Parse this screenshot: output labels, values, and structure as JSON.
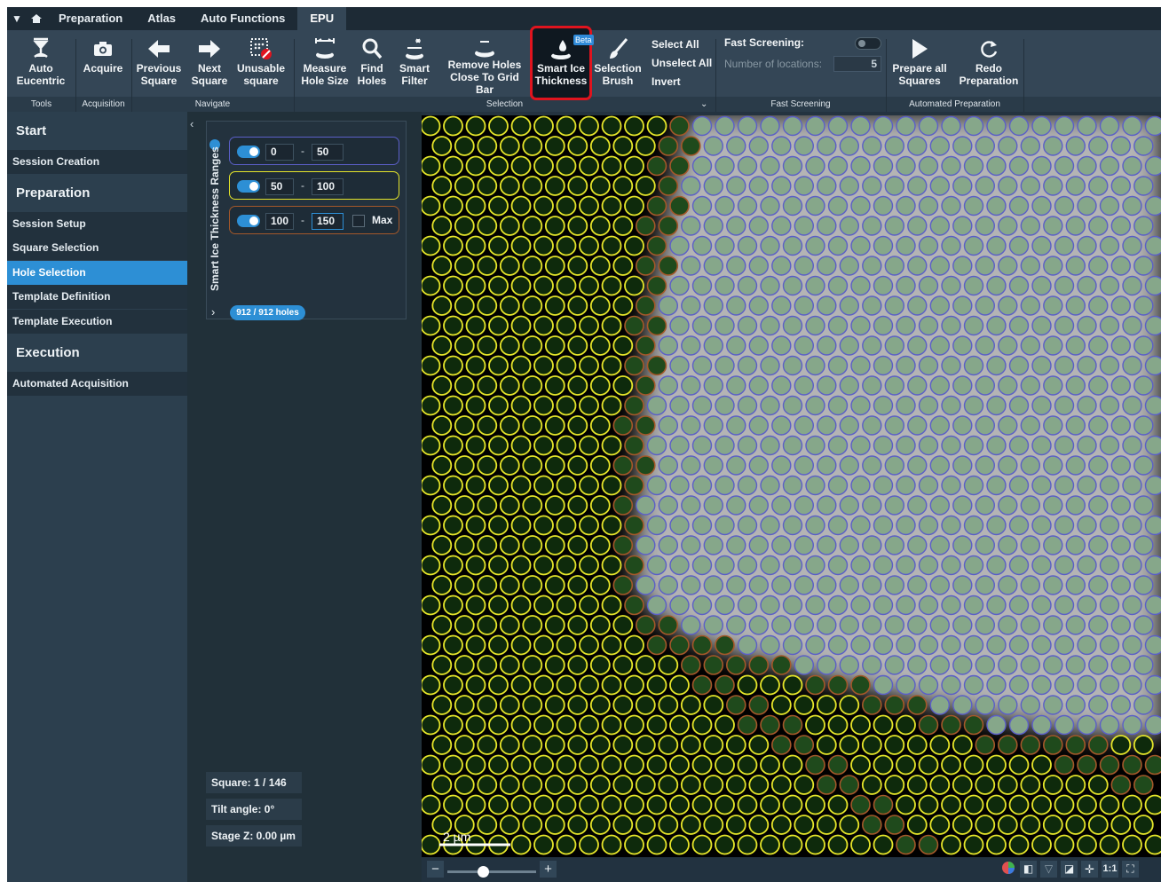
{
  "tabs": [
    {
      "label": "Preparation"
    },
    {
      "label": "Atlas"
    },
    {
      "label": "Auto Functions"
    },
    {
      "label": "EPU"
    }
  ],
  "ribbon": {
    "auto_eucentric": "Auto\nEucentric",
    "acquire": "Acquire",
    "previous_square": "Previous\nSquare",
    "next_square": "Next\nSquare",
    "unusable_square": "Unusable\nsquare",
    "measure_hole_size": "Measure\nHole Size",
    "find_holes": "Find\nHoles",
    "smart_filter": "Smart\nFilter",
    "remove_holes": "Remove Holes\nClose To Grid Bar",
    "smart_ice_thickness": "Smart Ice\nThickness",
    "beta": "Beta",
    "selection_brush": "Selection\nBrush",
    "select_all": "Select All",
    "unselect_all": "Unselect All",
    "invert": "Invert",
    "fast_screening_label": "Fast Screening:",
    "number_of_locations_label": "Number of locations:",
    "number_of_locations_value": "5",
    "prepare_all_squares": "Prepare all\nSquares",
    "redo_preparation": "Redo\nPreparation"
  },
  "groups": {
    "tools": "Tools",
    "acquisition": "Acquisition",
    "navigate": "Navigate",
    "selection": "Selection",
    "fast_screening": "Fast Screening",
    "automated_preparation": "Automated Preparation"
  },
  "sidebar": {
    "start": "Start",
    "session_creation": "Session Creation",
    "preparation": "Preparation",
    "session_setup": "Session Setup",
    "square_selection": "Square Selection",
    "hole_selection": "Hole Selection",
    "template_definition": "Template Definition",
    "template_execution": "Template Execution",
    "execution": "Execution",
    "automated_acquisition": "Automated Acquisition"
  },
  "ice_panel": {
    "title": "Smart Ice Thickness Ranges",
    "ranges": [
      {
        "from": "0",
        "to": "50",
        "color": "#5b5fc7"
      },
      {
        "from": "50",
        "to": "100",
        "color": "#e5e52a"
      },
      {
        "from": "100",
        "to": "150",
        "color": "#a4582a"
      }
    ],
    "max_label": "Max",
    "holes_count": "912 / 912 holes"
  },
  "info": {
    "square": "Square: 1 / 146",
    "tilt": "Tilt angle: 0°",
    "stage_z": "Stage Z:  0.00  µm"
  },
  "image": {
    "scale_label": "2 µm"
  },
  "bottom": {
    "zoom_fraction": 0.4,
    "one_to_one": "1:1"
  },
  "colors": {
    "accent": "#2d8fd5",
    "highlight": "#e0141e",
    "hole_thin": "#5b5fc7",
    "hole_mid": "#e5e52a",
    "hole_thick": "#a4582a"
  }
}
